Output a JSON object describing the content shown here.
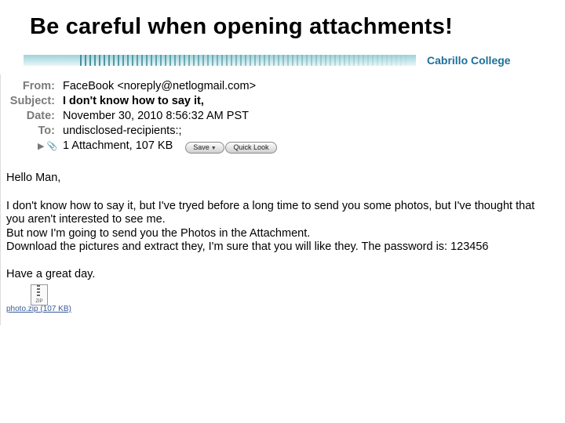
{
  "slide": {
    "title": "Be careful when opening attachments!",
    "banner_title": "Cabrillo College"
  },
  "email": {
    "headers": [
      {
        "label": "From:",
        "value": "FaceBook <noreply@netlogmail.com>",
        "bold": false
      },
      {
        "label": "Subject:",
        "value": "I don't know how to say it,",
        "bold": true
      },
      {
        "label": "Date:",
        "value": "November 30, 2010 8:56:32 AM PST",
        "bold": false
      },
      {
        "label": "To:",
        "value": "undisclosed-recipients:;",
        "bold": false
      }
    ],
    "attachment_summary": "1 Attachment, 107 KB",
    "save_label": "Save",
    "quicklook_label": "Quick Look",
    "greeting": "Hello Man,",
    "body_lines": [
      "I don't know how to say it, but I've tryed before a long time to send you some photos, but I've thought that",
      "you aren't interested to see me.",
      "But now I'm going to send you the Photos in the Attachment.",
      "Download the pictures and extract they, I'm sure that you will like they. The password is: 123456"
    ],
    "closing": "Have a great day.",
    "zip_icon_label": "ZIP",
    "attachment_link": "photo.zip (107 KB)"
  },
  "colors": {
    "banner_title": "#1d6f9a",
    "header_label": "#7a7a7a",
    "link": "#3a5a9a"
  }
}
